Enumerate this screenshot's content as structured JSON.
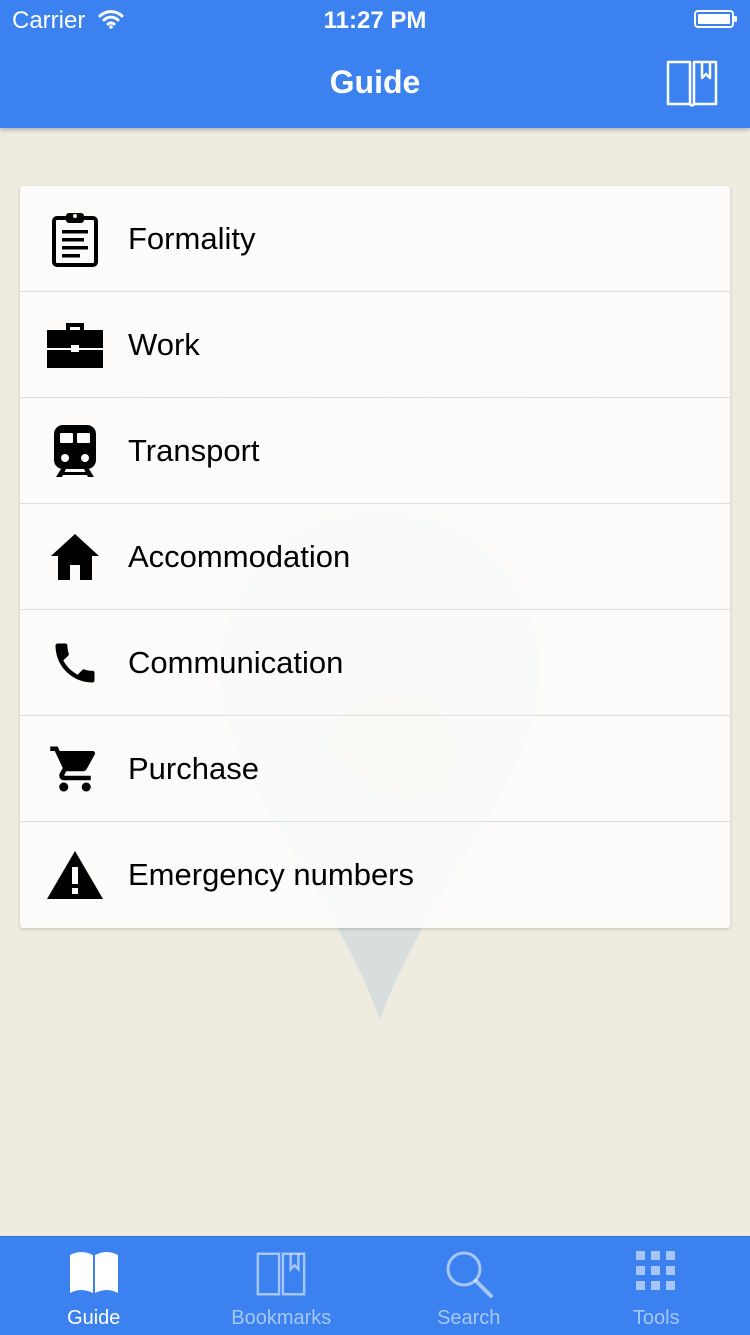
{
  "status_bar": {
    "carrier": "Carrier",
    "time": "11:27 PM"
  },
  "header": {
    "title": "Guide",
    "bookmark_icon": "book-bookmark-icon"
  },
  "watermark": {
    "line1": "SYDNEY",
    "line2": "EXPAT' GUIDE"
  },
  "menu": {
    "items": [
      {
        "label": "Formality",
        "icon": "clipboard-icon"
      },
      {
        "label": "Work",
        "icon": "briefcase-icon"
      },
      {
        "label": "Transport",
        "icon": "train-icon"
      },
      {
        "label": "Accommodation",
        "icon": "home-icon"
      },
      {
        "label": "Communication",
        "icon": "phone-icon"
      },
      {
        "label": "Purchase",
        "icon": "cart-icon"
      },
      {
        "label": "Emergency numbers",
        "icon": "warning-icon"
      }
    ]
  },
  "tabbar": {
    "tabs": [
      {
        "label": "Guide",
        "icon": "open-book-icon",
        "active": true
      },
      {
        "label": "Bookmarks",
        "icon": "bookmark-book-icon",
        "active": false
      },
      {
        "label": "Search",
        "icon": "search-icon",
        "active": false
      },
      {
        "label": "Tools",
        "icon": "grid-icon",
        "active": false
      }
    ]
  },
  "colors": {
    "accent": "#3b82f0",
    "background": "#eeece1"
  }
}
